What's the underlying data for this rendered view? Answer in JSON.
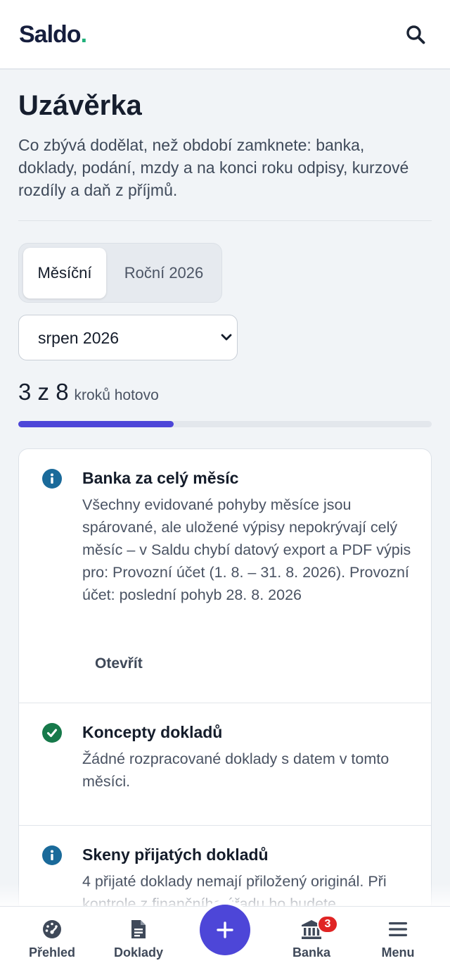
{
  "header": {
    "logo_text": "Saldo",
    "logo_dot": ".",
    "search_icon": "search-icon"
  },
  "page": {
    "title": "Uzávěrka",
    "description": "Co zbývá dodělat, než období zamknete: banka, doklady, podání, mzdy a na konci roku odpisy, kurzové rozdíly a daň z příjmů."
  },
  "tabs": {
    "monthly": "Měsíční",
    "yearly": "Roční 2026",
    "active": "monthly"
  },
  "period_select": {
    "value": "srpen 2026"
  },
  "progress": {
    "count": "3 z 8",
    "label": "kroků hotovo",
    "done": 3,
    "total": 8
  },
  "checklist": [
    {
      "status": "info",
      "title": "Banka za celý měsíc",
      "text": "Všechny evidované pohyby měsíce jsou spárované, ale uložené výpisy nepokrývají celý měsíc – v Saldu chybí datový export a PDF výpis pro: Provozní účet (1. 8. – 31. 8. 2026). Provozní účet: poslední pohyb 28. 8. 2026",
      "action": "Otevřít"
    },
    {
      "status": "done",
      "title": "Koncepty dokladů",
      "text": "Žádné rozpracované doklady s datem v tomto měsíci."
    },
    {
      "status": "info",
      "title": "Skeny přijatých dokladů",
      "text": "4 přijaté doklady nemají přiložený originál. Při kontrole z finančního úřadu ho budete"
    }
  ],
  "bottom_nav": {
    "overview": "Přehled",
    "documents": "Doklady",
    "bank": "Banka",
    "bank_badge": "3",
    "menu": "Menu"
  },
  "colors": {
    "accent": "#4d46d8",
    "info": "#1a6a9a",
    "success": "#16794a",
    "badge": "#e02424",
    "logo_dot": "#20b07a"
  }
}
